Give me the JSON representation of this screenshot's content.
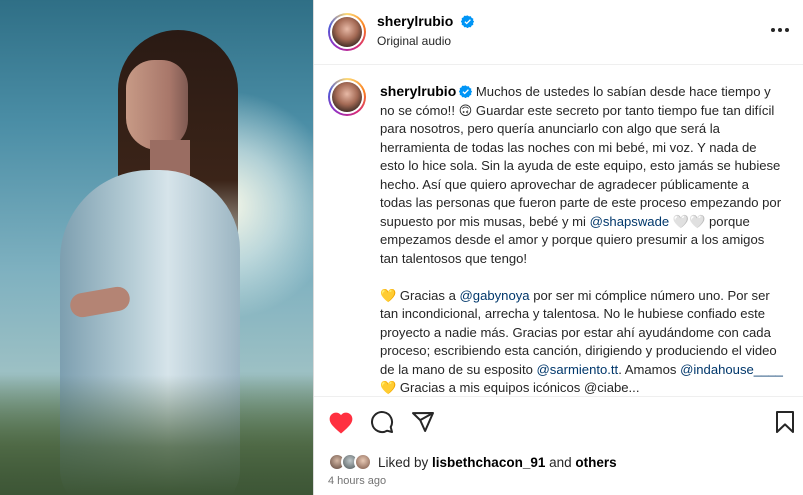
{
  "post": {
    "username": "sherylrubio",
    "audio": "Original audio",
    "time_ago": "4 hours ago"
  },
  "caption": {
    "p1_text": "Muchos de ustedes lo sabían desde hace tiempo y no se cómo!! 🙃 Guardar este secreto por tanto tiempo fue tan difícil para nosotros, pero quería anunciarlo con algo que será la herramienta de todas las noches con mi bebé, mi voz. Y nada de esto lo hice sola. Sin la ayuda de este equipo, esto jamás se hubiese hecho. Así que quiero aprovechar de agradecer públicamente a todas las personas que fueron parte de este proceso empezando por supuesto por mis musas, bebé y mi",
    "p1_mention": "@shapswade",
    "p1_tail": " 🤍🤍 porque empezamos desde el amor y porque quiero presumir a los amigos tan talentosos que tengo!",
    "p2_emoji": "💛",
    "p2_a": " Gracias a ",
    "p2_mention1": "@gabynoya",
    "p2_b": " por ser mi cómplice número uno. Por ser tan incondicional, arrecha y talentosa. No le hubiese confiado este proyecto a nadie más. Gracias por estar ahí ayudándome con cada proceso; escribiendo esta canción, dirigiendo y produciendo el video de la mano de su esposito ",
    "p2_mention2": "@sarmiento.tt",
    "p2_c": ". Amamos ",
    "p2_mention3": "@indahouse____",
    "p3_emoji": "💛",
    "p3_text": " Gracias a mis equipos icónicos @ciabe..."
  },
  "likes": {
    "prefix": "Liked by ",
    "user": "lisbethchacon_91",
    "middle": " and ",
    "others": "others"
  },
  "icons": {
    "verified": "verified-badge-icon",
    "more": "more-options-icon",
    "like": "heart-icon",
    "comment": "comment-icon",
    "share": "share-icon",
    "save": "bookmark-icon"
  },
  "colors": {
    "accent_blue": "#0095f6",
    "like_red": "#ff3040",
    "mention": "#00376b"
  }
}
